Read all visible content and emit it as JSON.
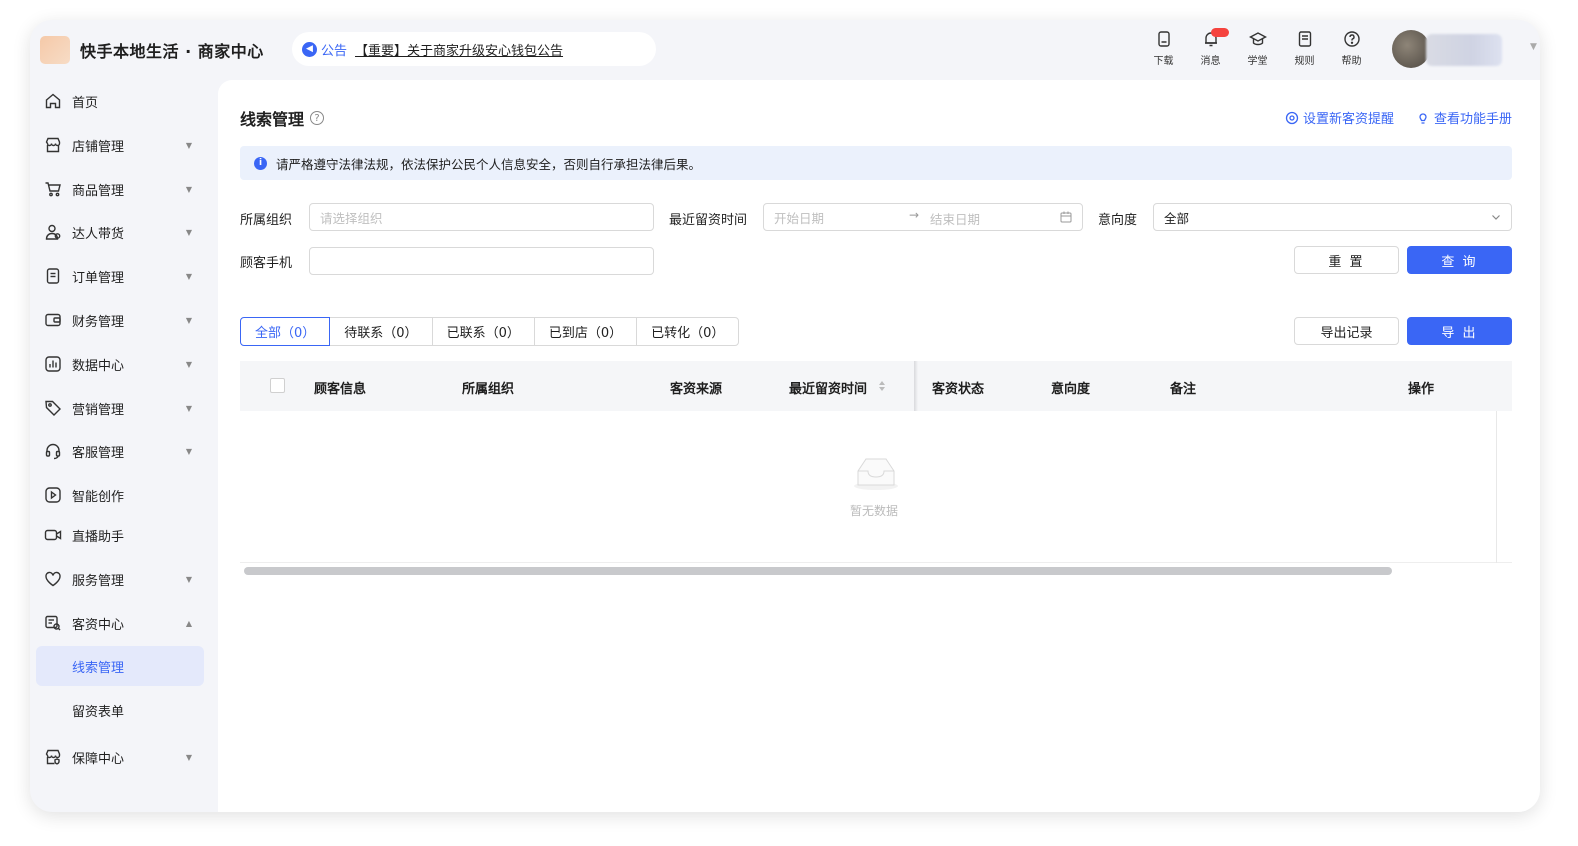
{
  "header": {
    "title": "快手本地生活 · 商家中心",
    "announcement": {
      "tag": "公告",
      "text": "【重要】关于商家升级安心钱包公告"
    },
    "tools": [
      {
        "label": "下载",
        "icon": "download-icon"
      },
      {
        "label": "消息",
        "icon": "bell-icon"
      },
      {
        "label": "学堂",
        "icon": "graduation-cap-icon"
      },
      {
        "label": "规则",
        "icon": "rules-doc-icon"
      },
      {
        "label": "帮助",
        "icon": "help-icon"
      }
    ]
  },
  "sidebar": {
    "items": [
      {
        "label": "首页",
        "icon": "home-icon"
      },
      {
        "label": "店铺管理",
        "icon": "store-icon"
      },
      {
        "label": "商品管理",
        "icon": "cart-icon"
      },
      {
        "label": "达人带货",
        "icon": "users-icon"
      },
      {
        "label": "订单管理",
        "icon": "order-icon"
      },
      {
        "label": "财务管理",
        "icon": "wallet-icon"
      },
      {
        "label": "数据中心",
        "icon": "chart-icon"
      },
      {
        "label": "营销管理",
        "icon": "tag-icon"
      },
      {
        "label": "客服管理",
        "icon": "headset-icon"
      },
      {
        "label": "智能创作",
        "icon": "play-icon"
      },
      {
        "label": "直播助手",
        "icon": "video-icon"
      },
      {
        "label": "服务管理",
        "icon": "heart-icon"
      },
      {
        "label": "客资中心",
        "icon": "customer-icon"
      },
      {
        "label": "保障中心",
        "icon": "shield-icon"
      }
    ],
    "sub_items": [
      {
        "label": "线索管理"
      },
      {
        "label": "留资表单"
      }
    ]
  },
  "main": {
    "title": "线索管理",
    "links": {
      "remind": "设置新客资提醒",
      "manual": "查看功能手册"
    },
    "alert": "请严格遵守法律法规，依法保护公民个人信息安全，否则自行承担法律后果。",
    "filters": {
      "org_label": "所属组织",
      "org_placeholder": "请选择组织",
      "time_label": "最近留资时间",
      "start_placeholder": "开始日期",
      "end_placeholder": "结束日期",
      "intent_label": "意向度",
      "intent_value": "全部",
      "phone_label": "顾客手机"
    },
    "buttons": {
      "reset": "重 置",
      "query": "查 询",
      "export_records": "导出记录",
      "export": "导 出"
    },
    "tabs": [
      "全部（0）",
      "待联系（0）",
      "已联系（0）",
      "已到店（0）",
      "已转化（0）"
    ],
    "table": {
      "columns": [
        "顾客信息",
        "所属组织",
        "客资来源",
        "最近留资时间",
        "客资状态",
        "意向度",
        "备注",
        "操作"
      ],
      "empty_text": "暂无数据"
    }
  },
  "colors": {
    "primary": "#3a66f5",
    "alert_bg": "#ebf1fc",
    "badge": "#f5433f"
  }
}
